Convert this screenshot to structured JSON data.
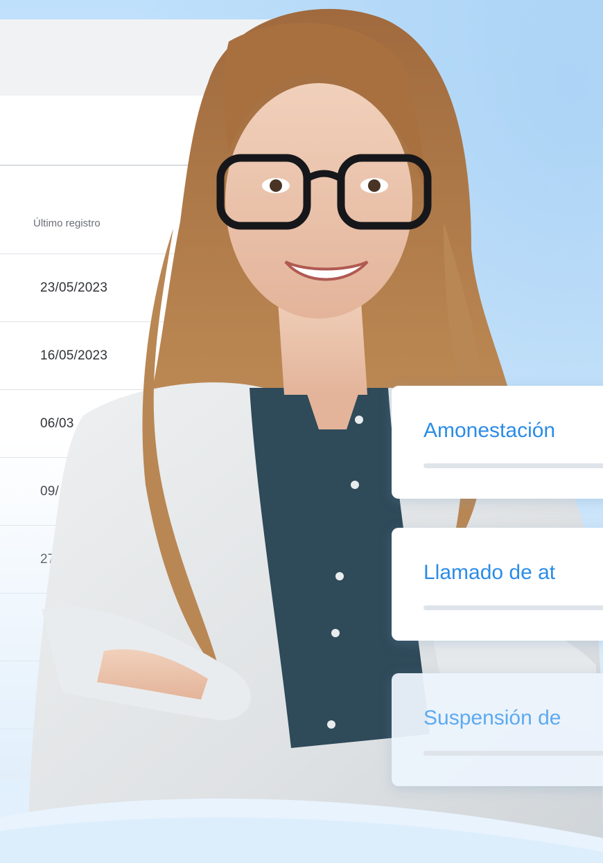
{
  "toolbar": {
    "add_icon_label": "+"
  },
  "table": {
    "column_header": "Último registro",
    "rows": [
      {
        "date": "23/05/2023"
      },
      {
        "date": "16/05/2023"
      },
      {
        "date": "06/03"
      },
      {
        "date": "09/"
      },
      {
        "date": "27"
      },
      {
        "date": ""
      },
      {
        "date": ""
      }
    ]
  },
  "cards": [
    {
      "title": "Amonestación"
    },
    {
      "title": "Llamado de at"
    },
    {
      "title": "Suspensión de"
    }
  ],
  "colors": {
    "accent": "#2b8ce6",
    "accent_light": "#5daaf0",
    "background": "#cfe6fb"
  },
  "icons": {
    "add": "plus-icon",
    "person": "woman-with-glasses-photo"
  }
}
